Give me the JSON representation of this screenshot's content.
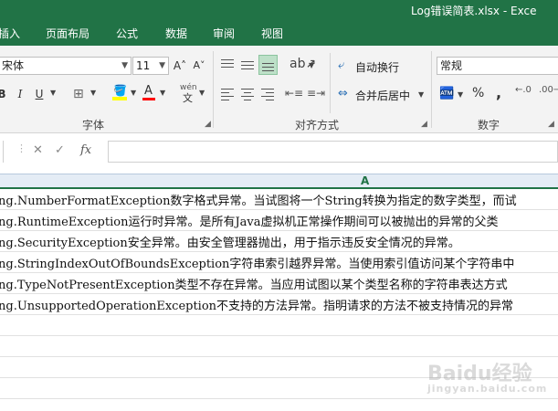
{
  "window": {
    "title": "Log错误简表.xlsx - Exce"
  },
  "tabs": [
    "插入",
    "页面布局",
    "公式",
    "数据",
    "审阅",
    "视图"
  ],
  "font": {
    "family_value": "宋体",
    "size_value": "11",
    "grow_label": "A˄",
    "shrink_label": "A˅",
    "bold_label": "B",
    "italic_label": "I",
    "underline_label": "U",
    "group_label": "字体"
  },
  "alignment": {
    "wrap_text_label": "自动换行",
    "merge_center_label": "合并后居中",
    "group_label": "对齐方式"
  },
  "number": {
    "format_value": "常规",
    "percent_label": "%",
    "comma_label": ",",
    "group_label": "数字"
  },
  "formula_bar": {
    "fx_label": "fx",
    "value": ""
  },
  "sheet": {
    "column_header": "A",
    "rows": [
      "ng.NumberFormatException数字格式异常。当试图将一个String转换为指定的数字类型，而试",
      "ng.RuntimeException运行时异常。是所有Java虚拟机正常操作期间可以被抛出的异常的父类",
      "ng.SecurityException安全异常。由安全管理器抛出，用于指示违反安全情况的异常。",
      "ng.StringIndexOutOfBoundsException字符串索引越界异常。当使用索引值访问某个字符串中",
      "ng.TypeNotPresentException类型不存在异常。当应用试图以某个类型名称的字符串表达方式",
      "ng.UnsupportedOperationException不支持的方法异常。指明请求的方法不被支持情况的异常",
      "",
      "",
      "",
      "",
      ""
    ]
  },
  "watermark": {
    "brand": "Baidu经验",
    "sub": "jingyan.baidu.com"
  },
  "colors": {
    "accent": "#217346",
    "ribbon_bg": "#f3f3f3",
    "fill_yellow": "#ffff00",
    "font_red": "#ff0000"
  }
}
